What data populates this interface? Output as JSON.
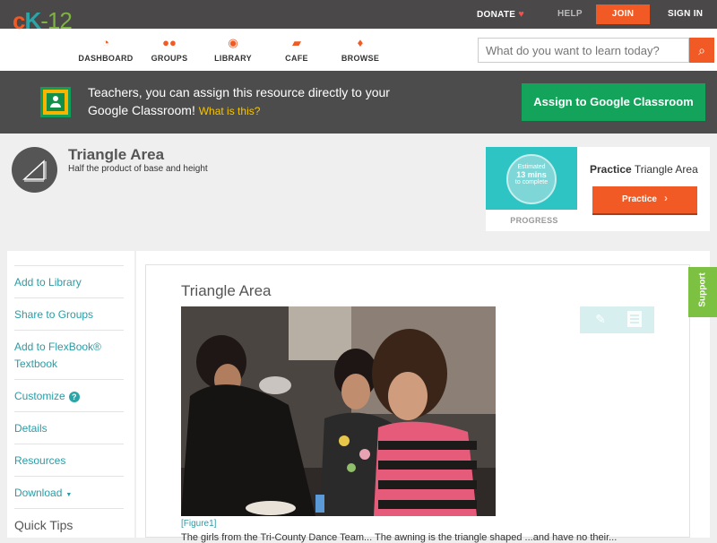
{
  "topbar": {
    "donate": "DONATE",
    "help": "HELP",
    "join": "JOIN",
    "signin": "SIGN IN"
  },
  "nav": {
    "logo": "cK-12",
    "items": [
      {
        "label": "DASHBOARD",
        "icon": "dashboard-icon"
      },
      {
        "label": "GROUPS",
        "icon": "groups-icon"
      },
      {
        "label": "LIBRARY",
        "icon": "library-icon"
      },
      {
        "label": "CAFE",
        "icon": "cafe-icon"
      },
      {
        "label": "BROWSE",
        "icon": "browse-icon"
      }
    ],
    "search_placeholder": "What do you want to learn today?"
  },
  "banner": {
    "text": "Teachers, you can assign this resource directly to your Google Classroom!",
    "whatis": "What is this?",
    "assign": "Assign to Google Classroom"
  },
  "concept": {
    "title": "Triangle Area",
    "subtitle": "Half the product of base and height"
  },
  "practice": {
    "estimated": "Estimated",
    "mins": "13 mins",
    "complete": "to complete",
    "progress_label": "PROGRESS",
    "title_bold": "Practice",
    "title_rest": "Triangle Area",
    "button": "Practice"
  },
  "sidebar": {
    "add_library": "Add to Library",
    "share_groups": "Share to Groups",
    "add_flexbook": "Add to FlexBook® Textbook",
    "customize": "Customize",
    "details": "Details",
    "resources": "Resources",
    "download": "Download",
    "quick_tips": "Quick Tips"
  },
  "main": {
    "article_title": "Triangle Area",
    "figure_caption": "[Figure1]",
    "body_text": "The girls from the Tri-County Dance Team... The awning is the triangle shaped ...and have no their..."
  },
  "support": "Support",
  "colors": {
    "accent": "#f15a24",
    "teal": "#2ba5a7",
    "green": "#14a35a",
    "support_green": "#7cc142"
  }
}
